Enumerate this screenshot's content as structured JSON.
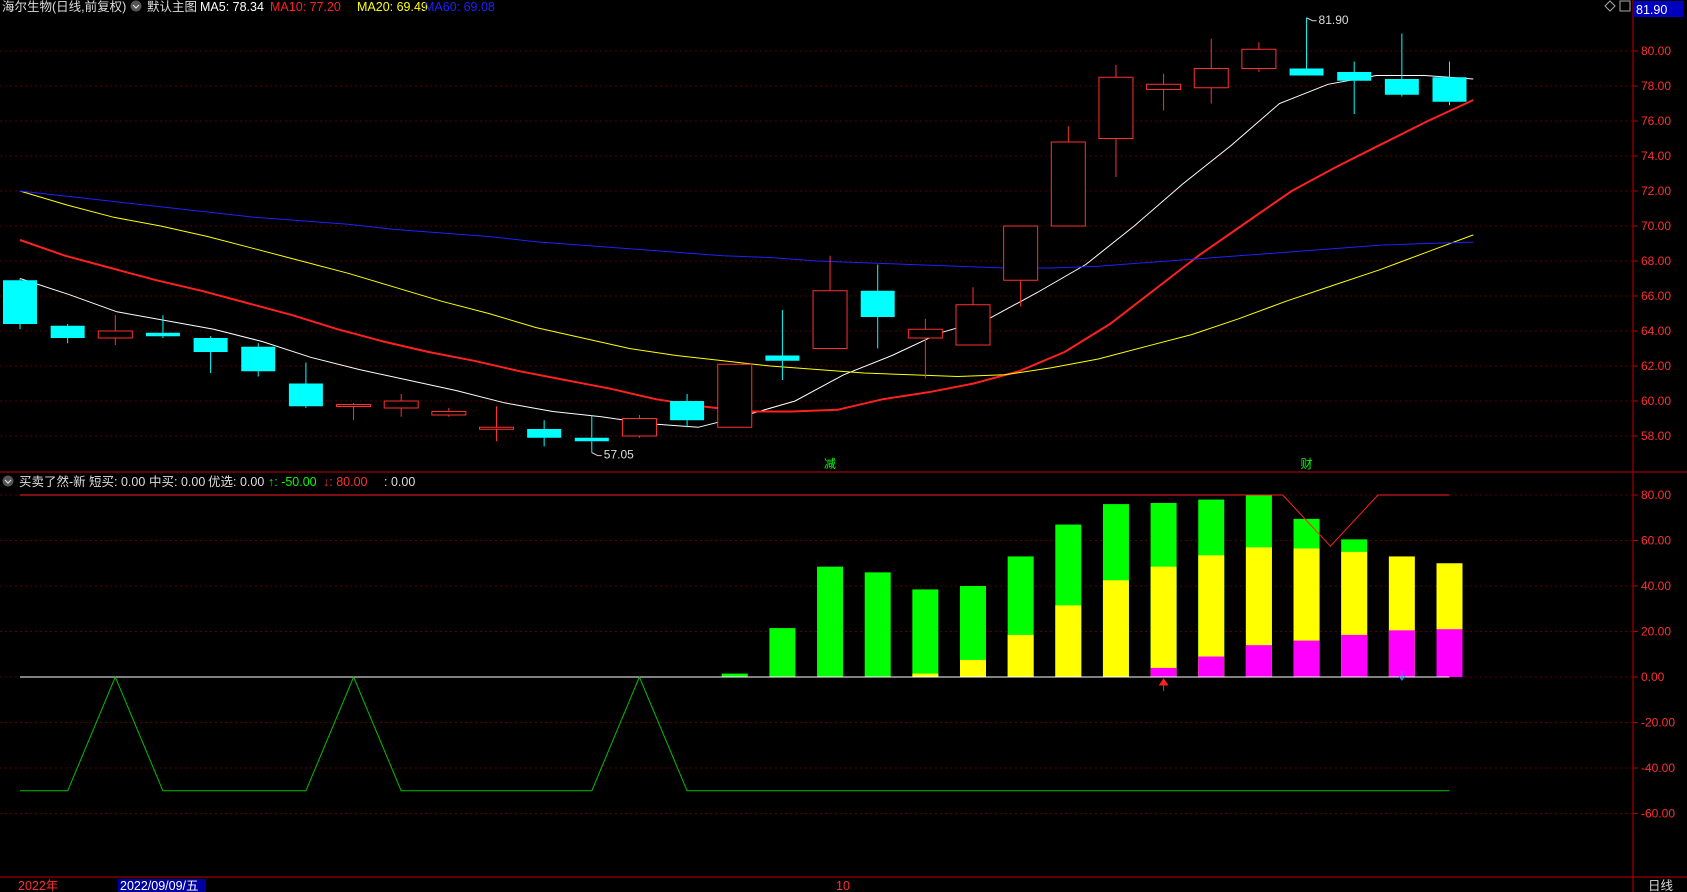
{
  "main_header": {
    "stock_title": "海尔生物(日线,前复权)",
    "template_label": "默认主图",
    "ma_items": [
      {
        "label": "MA5: 78.34",
        "color": "#ffffff"
      },
      {
        "label": "MA10: 77.20",
        "color": "#ff2020"
      },
      {
        "label": "MA20: 69.49",
        "color": "#ffff00"
      },
      {
        "label": "MA60: 69.08",
        "color": "#2020ff"
      }
    ],
    "top_right_price": "81.90"
  },
  "sub_header": {
    "indicator_name": "买卖了然-新",
    "items": [
      {
        "label": "短买: 0.00",
        "color": "#dddddd"
      },
      {
        "label": "中买: 0.00",
        "color": "#dddddd"
      },
      {
        "label": "优选: 0.00",
        "color": "#dddddd"
      },
      {
        "label": "↑: -50.00",
        "color": "#00ff00"
      },
      {
        "label": "↓: 80.00",
        "color": "#ff3030"
      },
      {
        "label": ": 0.00",
        "color": "#dddddd"
      }
    ]
  },
  "bottom_bar": {
    "year_label": "2022年",
    "cursor_date": "2022/09/09/五",
    "month_label": "10",
    "period_label": "日线"
  },
  "chart_data": [
    {
      "type": "candlestick",
      "ylim": [
        56.4,
        82.6
      ],
      "y_ticks": [
        58,
        60,
        62,
        64,
        66,
        68,
        70,
        72,
        74,
        76,
        78,
        80
      ],
      "y_tick_labels": [
        "58.00",
        "60.00",
        "62.00",
        "64.00",
        "66.00",
        "68.00",
        "70.00",
        "72.00",
        "74.00",
        "76.00",
        "78.00",
        "80.00"
      ],
      "grid": true,
      "candles": [
        {
          "o": 66.9,
          "h": 67.0,
          "l": 64.1,
          "c": 64.4
        },
        {
          "o": 64.3,
          "h": 64.4,
          "l": 63.3,
          "c": 63.6
        },
        {
          "o": 63.6,
          "h": 64.9,
          "l": 63.2,
          "c": 64.0
        },
        {
          "o": 63.9,
          "h": 64.9,
          "l": 63.6,
          "c": 63.7
        },
        {
          "o": 63.6,
          "h": 63.7,
          "l": 61.6,
          "c": 62.8
        },
        {
          "o": 63.1,
          "h": 63.3,
          "l": 61.4,
          "c": 61.7
        },
        {
          "o": 61.0,
          "h": 62.2,
          "l": 59.6,
          "c": 59.7
        },
        {
          "o": 59.7,
          "h": 59.9,
          "l": 58.9,
          "c": 59.8
        },
        {
          "o": 59.6,
          "h": 60.4,
          "l": 59.1,
          "c": 60.0
        },
        {
          "o": 59.2,
          "h": 59.6,
          "l": 59.1,
          "c": 59.4
        },
        {
          "o": 58.4,
          "h": 59.7,
          "l": 57.7,
          "c": 58.5
        },
        {
          "o": 58.4,
          "h": 58.9,
          "l": 57.4,
          "c": 57.9
        },
        {
          "o": 57.9,
          "h": 59.2,
          "l": 57.05,
          "c": 57.7
        },
        {
          "o": 58.0,
          "h": 59.2,
          "l": 57.9,
          "c": 59.0
        },
        {
          "o": 60.0,
          "h": 60.4,
          "l": 58.5,
          "c": 58.9
        },
        {
          "o": 58.5,
          "h": 62.1,
          "l": 58.5,
          "c": 62.1
        },
        {
          "o": 62.6,
          "h": 65.2,
          "l": 61.2,
          "c": 62.3
        },
        {
          "o": 63.0,
          "h": 68.3,
          "l": 63.0,
          "c": 66.3
        },
        {
          "o": 66.3,
          "h": 67.8,
          "l": 63.0,
          "c": 64.8
        },
        {
          "o": 63.6,
          "h": 64.7,
          "l": 61.3,
          "c": 64.1
        },
        {
          "o": 63.2,
          "h": 66.5,
          "l": 63.2,
          "c": 65.5
        },
        {
          "o": 66.9,
          "h": 70.0,
          "l": 65.4,
          "c": 70.0
        },
        {
          "o": 70.0,
          "h": 75.7,
          "l": 70.0,
          "c": 74.8
        },
        {
          "o": 75.0,
          "h": 79.2,
          "l": 72.8,
          "c": 78.5
        },
        {
          "o": 77.8,
          "h": 78.7,
          "l": 76.6,
          "c": 78.1
        },
        {
          "o": 77.9,
          "h": 80.7,
          "l": 77.0,
          "c": 79.0
        },
        {
          "o": 79.0,
          "h": 80.5,
          "l": 78.8,
          "c": 80.1
        },
        {
          "o": 79.0,
          "h": 81.9,
          "l": 78.7,
          "c": 78.6
        },
        {
          "o": 78.8,
          "h": 79.4,
          "l": 76.4,
          "c": 78.3
        },
        {
          "o": 78.4,
          "h": 81.0,
          "l": 77.4,
          "c": 77.5
        },
        {
          "o": 78.5,
          "h": 79.4,
          "l": 76.9,
          "c": 77.1
        }
      ],
      "series": [
        {
          "name": "MA5",
          "color": "#ffffff",
          "width": 1,
          "start": 0,
          "values": [
            67.0,
            66.1,
            65.1,
            64.6,
            64.1,
            63.4,
            62.5,
            61.8,
            61.2,
            60.6,
            59.9,
            59.4,
            59.1,
            58.7,
            58.5,
            59.2,
            60.0,
            61.5,
            62.6,
            63.9,
            64.7,
            66.2,
            67.8,
            70.0,
            72.4,
            74.6,
            77.0,
            78.1,
            78.6,
            78.6,
            78.4
          ]
        },
        {
          "name": "MA10",
          "color": "#ff2020",
          "width": 2,
          "start": 0,
          "values": [
            69.2,
            68.3,
            67.6,
            66.9,
            66.3,
            65.6,
            64.9,
            64.1,
            63.4,
            62.8,
            62.3,
            61.7,
            61.2,
            60.7,
            60.1,
            59.7,
            59.4,
            59.4,
            59.5,
            60.1,
            60.5,
            61.0,
            61.7,
            62.8,
            64.4,
            66.4,
            68.4,
            70.2,
            72.0,
            73.4,
            74.7,
            76.0,
            77.2
          ]
        },
        {
          "name": "MA20",
          "color": "#ffff00",
          "width": 1,
          "start": 0,
          "values": [
            72.0,
            71.2,
            70.5,
            70.0,
            69.4,
            68.7,
            68.0,
            67.3,
            66.5,
            65.7,
            65.0,
            64.2,
            63.6,
            63.0,
            62.6,
            62.3,
            62.0,
            61.8,
            61.6,
            61.5,
            61.4,
            61.5,
            61.9,
            62.4,
            63.1,
            63.8,
            64.7,
            65.7,
            66.6,
            67.5,
            68.5,
            69.49
          ]
        },
        {
          "name": "MA60",
          "color": "#2020ff",
          "width": 1,
          "start": 0,
          "values": [
            72.0,
            71.7,
            71.4,
            71.1,
            70.8,
            70.5,
            70.3,
            70.1,
            69.8,
            69.6,
            69.4,
            69.1,
            68.9,
            68.7,
            68.5,
            68.3,
            68.2,
            68.0,
            67.9,
            67.8,
            67.7,
            67.6,
            67.6,
            67.7,
            67.9,
            68.1,
            68.3,
            68.5,
            68.7,
            68.9,
            69.0,
            69.08
          ]
        }
      ],
      "annotations": [
        {
          "label": "57.05",
          "candle": 12,
          "value": 57.05
        },
        {
          "label": "81.90",
          "candle": 27,
          "value": 81.9
        }
      ],
      "markers": [
        {
          "label": "减",
          "candle": 17,
          "color": "#00ff00"
        },
        {
          "label": "财",
          "candle": 27,
          "color": "#00ff00"
        }
      ]
    },
    {
      "type": "bar",
      "ylim": [
        -70,
        82
      ],
      "y_ticks": [
        80,
        60,
        40,
        20,
        0,
        -20,
        -40,
        -60
      ],
      "y_tick_labels": [
        "80.00",
        "60.00",
        "40.00",
        "20.00",
        "0.00",
        "-20.00",
        "-40.00",
        "-60.00"
      ],
      "grid": true,
      "bars": [
        {
          "green": 1.5,
          "yellow": 0,
          "magenta": 0
        },
        {
          "green": 21.5,
          "yellow": 0,
          "magenta": 0
        },
        {
          "green": 48.5,
          "yellow": 0,
          "magenta": 0
        },
        {
          "green": 46,
          "yellow": 0,
          "magenta": 0
        },
        {
          "green": 38.5,
          "yellow": 1.5,
          "magenta": 0
        },
        {
          "green": 40,
          "yellow": 7.5,
          "magenta": 0
        },
        {
          "green": 53,
          "yellow": 18.5,
          "magenta": 0
        },
        {
          "green": 67,
          "yellow": 31.5,
          "magenta": 0
        },
        {
          "green": 76,
          "yellow": 42.5,
          "magenta": 0
        },
        {
          "green": 76.5,
          "yellow": 48.5,
          "magenta": 4
        },
        {
          "green": 78,
          "yellow": 53.5,
          "magenta": 9
        },
        {
          "green": 80,
          "yellow": 57,
          "magenta": 14
        },
        {
          "green": 69.5,
          "yellow": 56.5,
          "magenta": 16
        },
        {
          "green": 60.5,
          "yellow": 55,
          "magenta": 18.5
        },
        {
          "green": 0,
          "yellow": 53,
          "magenta": 20.5
        },
        {
          "green": 0,
          "yellow": 50,
          "magenta": 21
        }
      ],
      "lines": [
        {
          "name": "zero",
          "color": "#ffffff",
          "points": [
            [
              0,
              0
            ],
            [
              30,
              0
            ]
          ]
        },
        {
          "name": "red",
          "color": "#ff2020",
          "points": [
            [
              0,
              80
            ],
            [
              26.5,
              80
            ],
            [
              27.5,
              57.5
            ],
            [
              28.5,
              80
            ],
            [
              30,
              80
            ]
          ]
        },
        {
          "name": "green",
          "color": "#00c000",
          "points": [
            [
              0,
              -50
            ],
            [
              1,
              -50
            ],
            [
              2,
              0
            ],
            [
              3,
              -50
            ],
            [
              6,
              -50
            ],
            [
              7,
              0
            ],
            [
              8,
              -50
            ],
            [
              12,
              -50
            ],
            [
              13,
              0
            ],
            [
              14,
              -50
            ],
            [
              30,
              -50
            ]
          ]
        }
      ],
      "arrows": [
        {
          "candle": 24,
          "direction": "up",
          "color": "#ff2020"
        },
        {
          "candle": 29,
          "direction": "down",
          "color": "#00a0ff"
        }
      ]
    }
  ]
}
